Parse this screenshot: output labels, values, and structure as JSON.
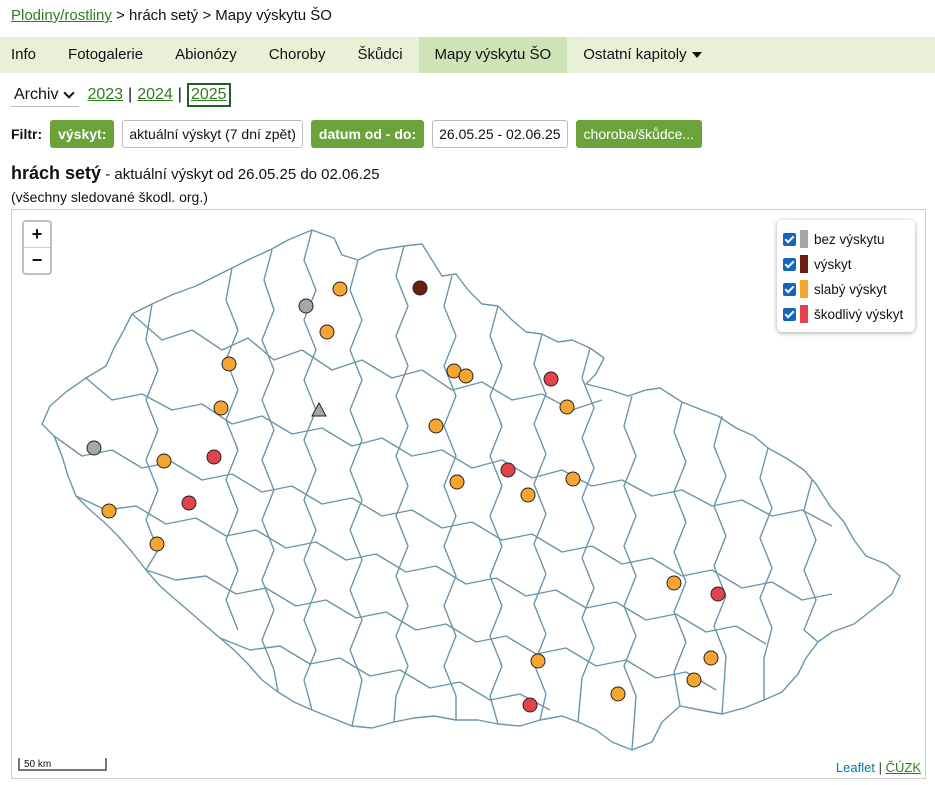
{
  "breadcrumb": {
    "link": "Plodiny/rostliny",
    "rest": " > hrách setý > Mapy výskytu ŠO"
  },
  "nav": {
    "tabs": [
      "Info",
      "Fotogalerie",
      "Abionózy",
      "Choroby",
      "Škůdci",
      "Mapy výskytu ŠO",
      "Ostatní kapitoly"
    ],
    "active": 5
  },
  "archive": {
    "select_label": "Archiv",
    "years": [
      "2023",
      "2024",
      "2025"
    ],
    "current": "2025"
  },
  "filter": {
    "label": "Filtr:",
    "occurrence_btn": "výskyt:",
    "occurrence_value": "aktuální výskyt (7 dní zpět)",
    "date_btn": "datum od - do:",
    "date_value": "26.05.25 - 02.06.25",
    "organism_btn": "choroba/škůdce..."
  },
  "title": {
    "crop": "hrách setý",
    "detail": " - aktuální výskyt od 26.05.25 do 02.06.25"
  },
  "subtitle": "(všechny sledované škodl. org.)",
  "map": {
    "zoom_in": "+",
    "zoom_out": "−",
    "legend": [
      {
        "label": "bez výskytu",
        "color": "#a6a6a6"
      },
      {
        "label": "výskyt",
        "color": "#6b1e0f"
      },
      {
        "label": "slabý výskyt",
        "color": "#f6a531"
      },
      {
        "label": "škodlivý výskyt",
        "color": "#e2444b"
      }
    ],
    "scale_label": "50 km",
    "attribution": {
      "leaflet": "Leaflet",
      "sep": "|",
      "cuzk": "ČÚZK"
    },
    "colors": {
      "border": "#6b95ab",
      "accent": "#6aa339"
    }
  }
}
